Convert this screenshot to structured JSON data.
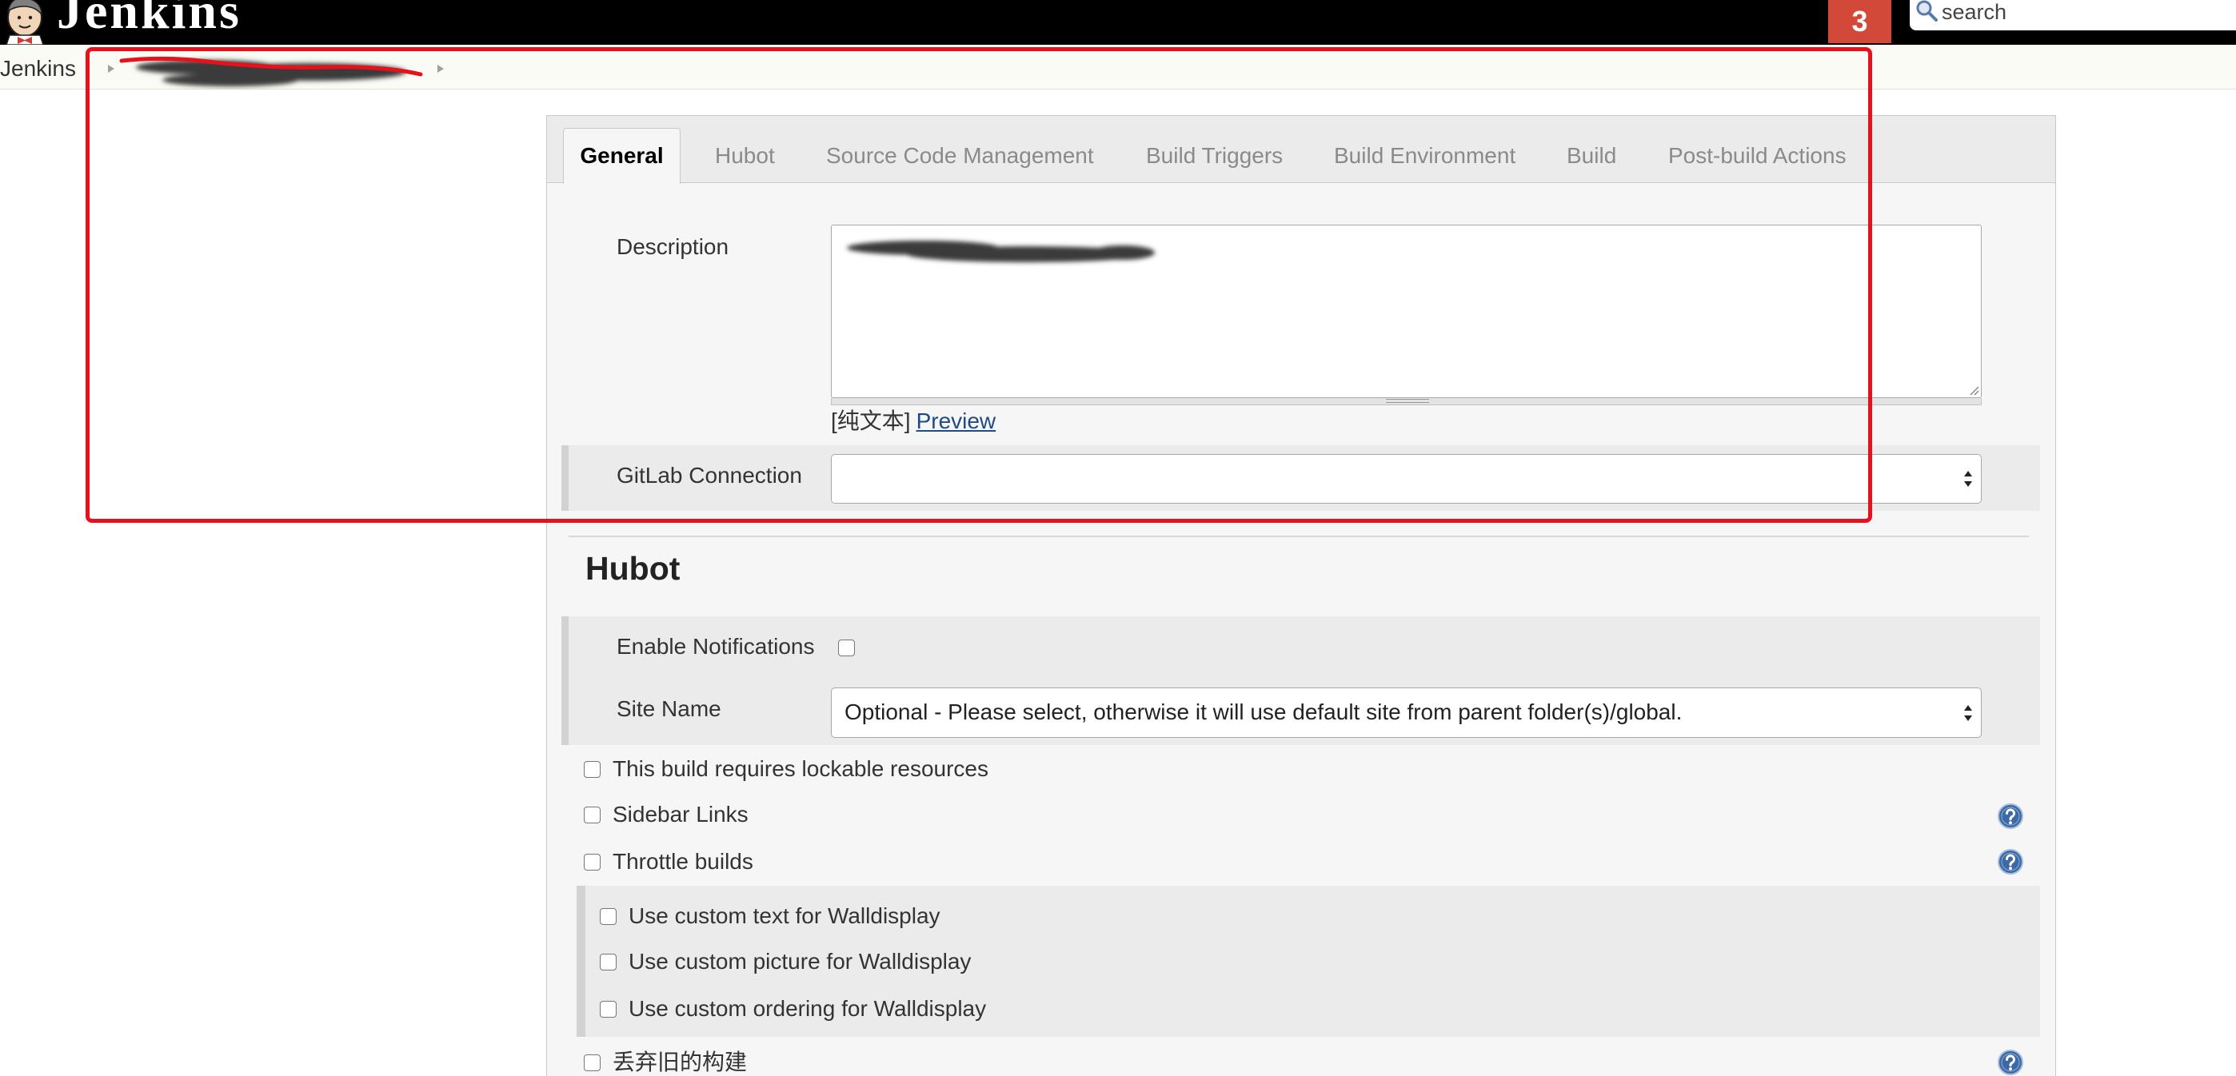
{
  "header": {
    "app_name": "Jenkins",
    "logo_icon": "jenkins-butler-icon",
    "notification_count": "3",
    "search_placeholder": "search",
    "search_icon": "search-icon"
  },
  "breadcrumb": {
    "root": "Jenkins",
    "separator_icon": "chevron-right-icon"
  },
  "tabs": [
    {
      "label": "General",
      "active": true
    },
    {
      "label": "Hubot",
      "active": false
    },
    {
      "label": "Source Code Management",
      "active": false
    },
    {
      "label": "Build Triggers",
      "active": false
    },
    {
      "label": "Build Environment",
      "active": false
    },
    {
      "label": "Build",
      "active": false
    },
    {
      "label": "Post-build Actions",
      "active": false
    }
  ],
  "general": {
    "description_label": "Description",
    "markup_format": "[纯文本]",
    "preview_link": "Preview",
    "gitlab_connection_label": "GitLab Connection",
    "gitlab_connection_value": ""
  },
  "hubot": {
    "heading": "Hubot",
    "enable_notifications_label": "Enable Notifications",
    "enable_notifications_checked": false,
    "site_name_label": "Site Name",
    "site_name_value": "Optional - Please select, otherwise it will use default site from parent folder(s)/global."
  },
  "options": [
    {
      "label": "This build requires lockable resources",
      "checked": false,
      "has_help": false
    },
    {
      "label": "Sidebar Links",
      "checked": false,
      "has_help": true
    },
    {
      "label": "Throttle builds",
      "checked": false,
      "has_help": true
    }
  ],
  "walldisplay": [
    {
      "label": "Use custom text for Walldisplay",
      "checked": false
    },
    {
      "label": "Use custom picture for Walldisplay",
      "checked": false
    },
    {
      "label": "Use custom ordering for Walldisplay",
      "checked": false
    }
  ],
  "discard_old_builds": {
    "label": "丢弃旧的构建",
    "checked": false,
    "has_help": true
  },
  "icons": {
    "help": "help-icon",
    "select_arrows": "select-arrows-icon"
  },
  "colors": {
    "header_background": "#000000",
    "notification_badge": "#d24939",
    "annotation_highlight": "#e8101a",
    "link": "#204a87",
    "help_icon": "#3c6aa8"
  }
}
